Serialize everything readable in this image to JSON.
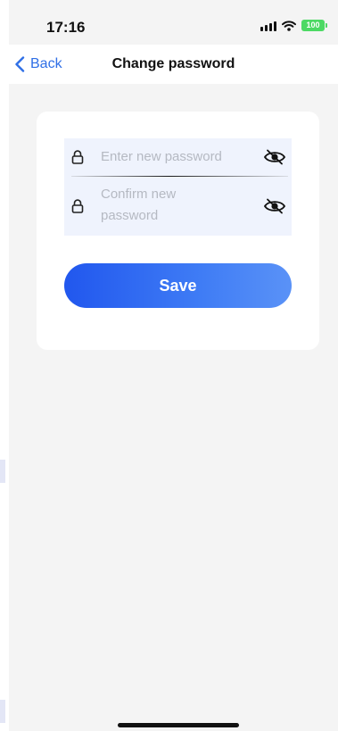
{
  "status_bar": {
    "time": "17:16",
    "battery": "100",
    "icons": [
      "cellular-signal-icon",
      "wifi-icon",
      "battery-icon"
    ]
  },
  "nav": {
    "back_label": "Back",
    "title": "Change password"
  },
  "form": {
    "new_password": {
      "placeholder": "Enter new password",
      "value": "",
      "icon": "lock-icon",
      "toggle_icon": "eye-slash-icon"
    },
    "confirm_password": {
      "placeholder": "Confirm new password",
      "value": "",
      "icon": "lock-icon",
      "toggle_icon": "eye-slash-icon"
    },
    "save_label": "Save"
  },
  "colors": {
    "accent": "#2f6fe6",
    "button_gradient_start": "#2157ee",
    "button_gradient_end": "#5a92f7",
    "field_background": "#eff3fd",
    "page_background": "#f4f4f4",
    "battery": "#4cd964"
  }
}
